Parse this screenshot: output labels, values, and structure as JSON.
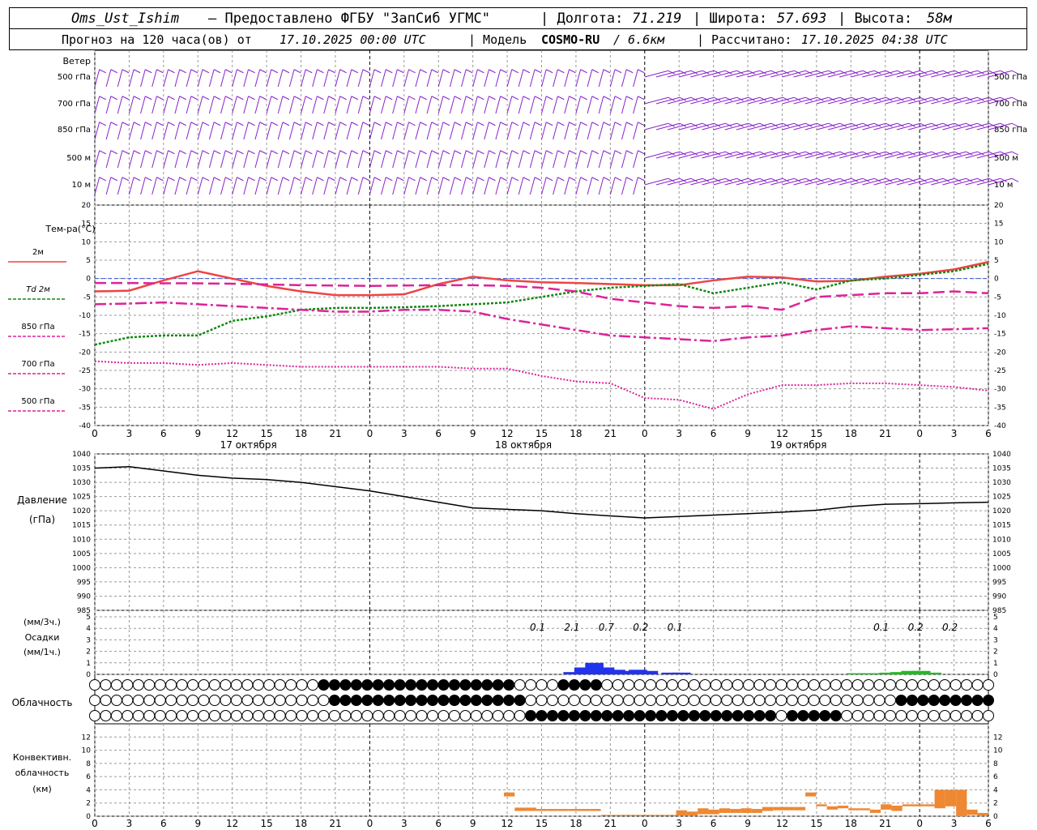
{
  "header": {
    "station": "Oms_Ust_Ishim",
    "provided": "– Предоставлено ФГБУ \"ЗапСиб УГМС\"",
    "lon_label": "| Долгота:",
    "lon_value": "71.219",
    "lat_label": "| Широта:",
    "lat_value": "57.693",
    "alt_label": "| Высота:",
    "alt_value": "58м",
    "forecast_label": "Прогноз на 120 часа(ов) от",
    "forecast_from": "17.10.2025 00:00 UTC",
    "model_label": "| Модель",
    "model_name": "COSMO-RU",
    "model_res": "/ 6.6км",
    "calc_label": "| Рассчитано:",
    "calc_value": "17.10.2025 04:38 UTC"
  },
  "panels": {
    "wind": {
      "title": "Ветер",
      "levels": [
        "500 гПа",
        "700 гПа",
        "850 гПа",
        "500 м",
        "10 м"
      ]
    },
    "temperature": {
      "title": "Тем-ра(°С)",
      "legend": [
        "2м",
        "Td 2м",
        "850 гПа",
        "700 гПа",
        "500 гПа"
      ]
    },
    "pressure": {
      "title": "Давление",
      "unit": "(гПа)"
    },
    "precip": {
      "unit3": "(мм/3ч.)",
      "title": "Осадки",
      "unit1": "(мм/1ч.)"
    },
    "cloud": {
      "title": "Облачность"
    },
    "convective": {
      "title1": "Конвективн.",
      "title2": "облачность",
      "unit": "(км)"
    }
  },
  "chart_data": [
    {
      "type": "line",
      "title": "Тем-ра(°С)",
      "x_hours_labels": [
        "0",
        "3",
        "6",
        "9",
        "12",
        "15",
        "18",
        "21",
        "0",
        "3",
        "6",
        "9",
        "12",
        "15",
        "18",
        "21",
        "0",
        "3",
        "6",
        "9",
        "12",
        "15",
        "18",
        "21",
        "0",
        "3",
        "6"
      ],
      "days": [
        "17 октября",
        "18 октября",
        "19 октября"
      ],
      "ylim": [
        -40,
        20
      ],
      "yticks": [
        20,
        15,
        10,
        5,
        0,
        -5,
        -10,
        -15,
        -20,
        -25,
        -30,
        -35,
        -40
      ],
      "x_hours": [
        0,
        3,
        6,
        9,
        12,
        15,
        18,
        21,
        24,
        27,
        30,
        33,
        36,
        39,
        42,
        45,
        48,
        51,
        54,
        57,
        60,
        63,
        66,
        69,
        72,
        75,
        78
      ],
      "colors": {
        "t2m": "#ee4444",
        "td2m": "#118811",
        "t850": "#dd2299",
        "t700": "#dd2299",
        "t500": "#dd2299"
      },
      "series": [
        {
          "name": "2м",
          "values": [
            -3.5,
            -3.3,
            -0.5,
            2,
            0,
            -2,
            -3.5,
            -4.5,
            -4.5,
            -4.3,
            -1.5,
            0.5,
            -0.5,
            -1,
            -1.2,
            -1.5,
            -1.8,
            -1.8,
            -0.5,
            0.5,
            0.3,
            -0.8,
            -0.6,
            0.5,
            1.3,
            2.5,
            4.5
          ]
        },
        {
          "name": "Td 2м",
          "values": [
            -18,
            -16,
            -15.5,
            -15.5,
            -11.5,
            -10.3,
            -8.5,
            -8,
            -8,
            -7.8,
            -7.5,
            -7,
            -6.5,
            -5,
            -3.5,
            -2.5,
            -2,
            -1.5,
            -4,
            -2.5,
            -1,
            -3,
            -0.5,
            0,
            1,
            2,
            4
          ]
        },
        {
          "name": "850 гПа",
          "values": [
            -1.2,
            -1.2,
            -1.3,
            -1.3,
            -1.4,
            -1.6,
            -1.8,
            -1.9,
            -2,
            -1.9,
            -1.8,
            -1.8,
            -2,
            -2.5,
            -3.5,
            -5.5,
            -6.5,
            -7.5,
            -8,
            -7.5,
            -8.5,
            -5,
            -4.5,
            -4,
            -4,
            -3.5,
            -4
          ]
        },
        {
          "name": "700 гПа",
          "values": [
            -7,
            -6.8,
            -6.5,
            -7,
            -7.5,
            -8,
            -8.5,
            -9,
            -9,
            -8.5,
            -8.5,
            -9,
            -11,
            -12.5,
            -14,
            -15.5,
            -16,
            -16.5,
            -17,
            -16,
            -15.5,
            -14,
            -13,
            -13.5,
            -14,
            -13.8,
            -13.5
          ]
        },
        {
          "name": "500 гПа",
          "values": [
            -22.5,
            -23,
            -23,
            -23.5,
            -23,
            -23.5,
            -24,
            -24,
            -24,
            -24,
            -24,
            -24.5,
            -24.5,
            -26.5,
            -28,
            -28.5,
            -32.5,
            -33,
            -35.5,
            -31.5,
            -29,
            -29,
            -28.5,
            -28.5,
            -29,
            -29.5,
            -30.5
          ]
        }
      ]
    },
    {
      "type": "line",
      "title": "Давление",
      "ylabel": "(гПа)",
      "ylim": [
        985,
        1040
      ],
      "yticks": [
        1040,
        1035,
        1030,
        1025,
        1020,
        1015,
        1010,
        1005,
        1000,
        995,
        990,
        985
      ],
      "x_hours": [
        0,
        3,
        6,
        9,
        12,
        15,
        18,
        21,
        24,
        27,
        30,
        33,
        36,
        39,
        42,
        45,
        48,
        51,
        54,
        57,
        60,
        63,
        66,
        69,
        72,
        75,
        78
      ],
      "series": [
        {
          "name": "",
          "values": [
            1035,
            1035.5,
            1034,
            1032.5,
            1031.5,
            1031,
            1030,
            1028.5,
            1027,
            1025,
            1023,
            1021,
            1020.5,
            1020,
            1019,
            1018.2,
            1017.5,
            1018,
            1018.5,
            1019,
            1019.5,
            1020.2,
            1021.5,
            1022.3,
            1022.5,
            1022.8,
            1023
          ]
        }
      ]
    },
    {
      "type": "bar",
      "title": "Осадки",
      "ylim": [
        0,
        5
      ],
      "yticks": [
        5,
        4,
        3,
        2,
        1,
        0
      ],
      "labels": [
        {
          "x": 39,
          "text": "0.1"
        },
        {
          "x": 42,
          "text": "2.1"
        },
        {
          "x": 45,
          "text": "0.7"
        },
        {
          "x": 48,
          "text": "0.2"
        },
        {
          "x": 51,
          "text": "0.1"
        },
        {
          "x": 69,
          "text": "0.1"
        },
        {
          "x": 72,
          "text": "0.2"
        },
        {
          "x": 75,
          "text": "0.2"
        }
      ],
      "series": [
        {
          "name": "blue",
          "color": "#2233ee",
          "bars": [
            [
              43,
              0.2
            ],
            [
              44,
              0.6
            ],
            [
              45,
              1
            ],
            [
              46,
              0.6
            ],
            [
              47,
              0.4
            ],
            [
              48,
              0.3
            ],
            [
              49,
              0.4
            ],
            [
              50,
              0.3
            ],
            [
              52,
              0.15
            ],
            [
              53,
              0.15
            ]
          ]
        },
        {
          "name": "green",
          "color": "#22bb22",
          "bars": [
            [
              69,
              0.1
            ],
            [
              70,
              0.1
            ],
            [
              71,
              0.1
            ],
            [
              72,
              0.15
            ],
            [
              73,
              0.2
            ],
            [
              74,
              0.3
            ],
            [
              75,
              0.3
            ],
            [
              76,
              0.15
            ]
          ]
        }
      ]
    },
    {
      "type": "bar",
      "title": "Конвективн. облачность",
      "ylabel": "(км)",
      "ylim": [
        0,
        13
      ],
      "yticks": [
        12,
        10,
        8,
        6,
        4,
        2,
        0
      ],
      "color": "#ee8833",
      "bars": [
        [
          38,
          3,
          3.6
        ],
        [
          39,
          0.8,
          1.3
        ],
        [
          40,
          0.8,
          1.3
        ],
        [
          41,
          0.8,
          1.1
        ],
        [
          42,
          0.8,
          1.1
        ],
        [
          43,
          0.8,
          1.1
        ],
        [
          44,
          0.8,
          1.1
        ],
        [
          45,
          0.8,
          1.1
        ],
        [
          46,
          0.8,
          1.1
        ],
        [
          47,
          0.1,
          0.2
        ],
        [
          48,
          0.1,
          0.2
        ],
        [
          49,
          0.1,
          0.2
        ],
        [
          50,
          0.1,
          0.2
        ],
        [
          51,
          0.1,
          0.2
        ],
        [
          52,
          0.1,
          0.2
        ],
        [
          53,
          0.1,
          0.2
        ],
        [
          54,
          0.1,
          0.9
        ],
        [
          55,
          0.1,
          0.7
        ],
        [
          56,
          0.3,
          1.2
        ],
        [
          57,
          0.3,
          1
        ],
        [
          58,
          0.5,
          1.2
        ],
        [
          59,
          0.5,
          1.1
        ],
        [
          60,
          0.5,
          1.2
        ],
        [
          61,
          0.5,
          1.1
        ],
        [
          62,
          0.8,
          1.4
        ],
        [
          63,
          0.9,
          1.4
        ],
        [
          64,
          0.9,
          1.4
        ],
        [
          65,
          0.9,
          1.4
        ],
        [
          66,
          3,
          3.6
        ],
        [
          67,
          1.5,
          1.8
        ],
        [
          68,
          1,
          1.5
        ],
        [
          69,
          1.2,
          1.6
        ],
        [
          70,
          0.9,
          1.2
        ],
        [
          71,
          0.9,
          1.2
        ],
        [
          72,
          0.5,
          1
        ],
        [
          73,
          1,
          1.8
        ],
        [
          74,
          0.8,
          1.6
        ],
        [
          75,
          1.5,
          1.8
        ],
        [
          76,
          1.5,
          1.8
        ],
        [
          77,
          1.5,
          1.8
        ],
        [
          78,
          1.2,
          4
        ],
        [
          79,
          1.5,
          4
        ],
        [
          80,
          0,
          4
        ],
        [
          81,
          0.2,
          1
        ],
        [
          82,
          0.1,
          0.5
        ]
      ]
    }
  ]
}
